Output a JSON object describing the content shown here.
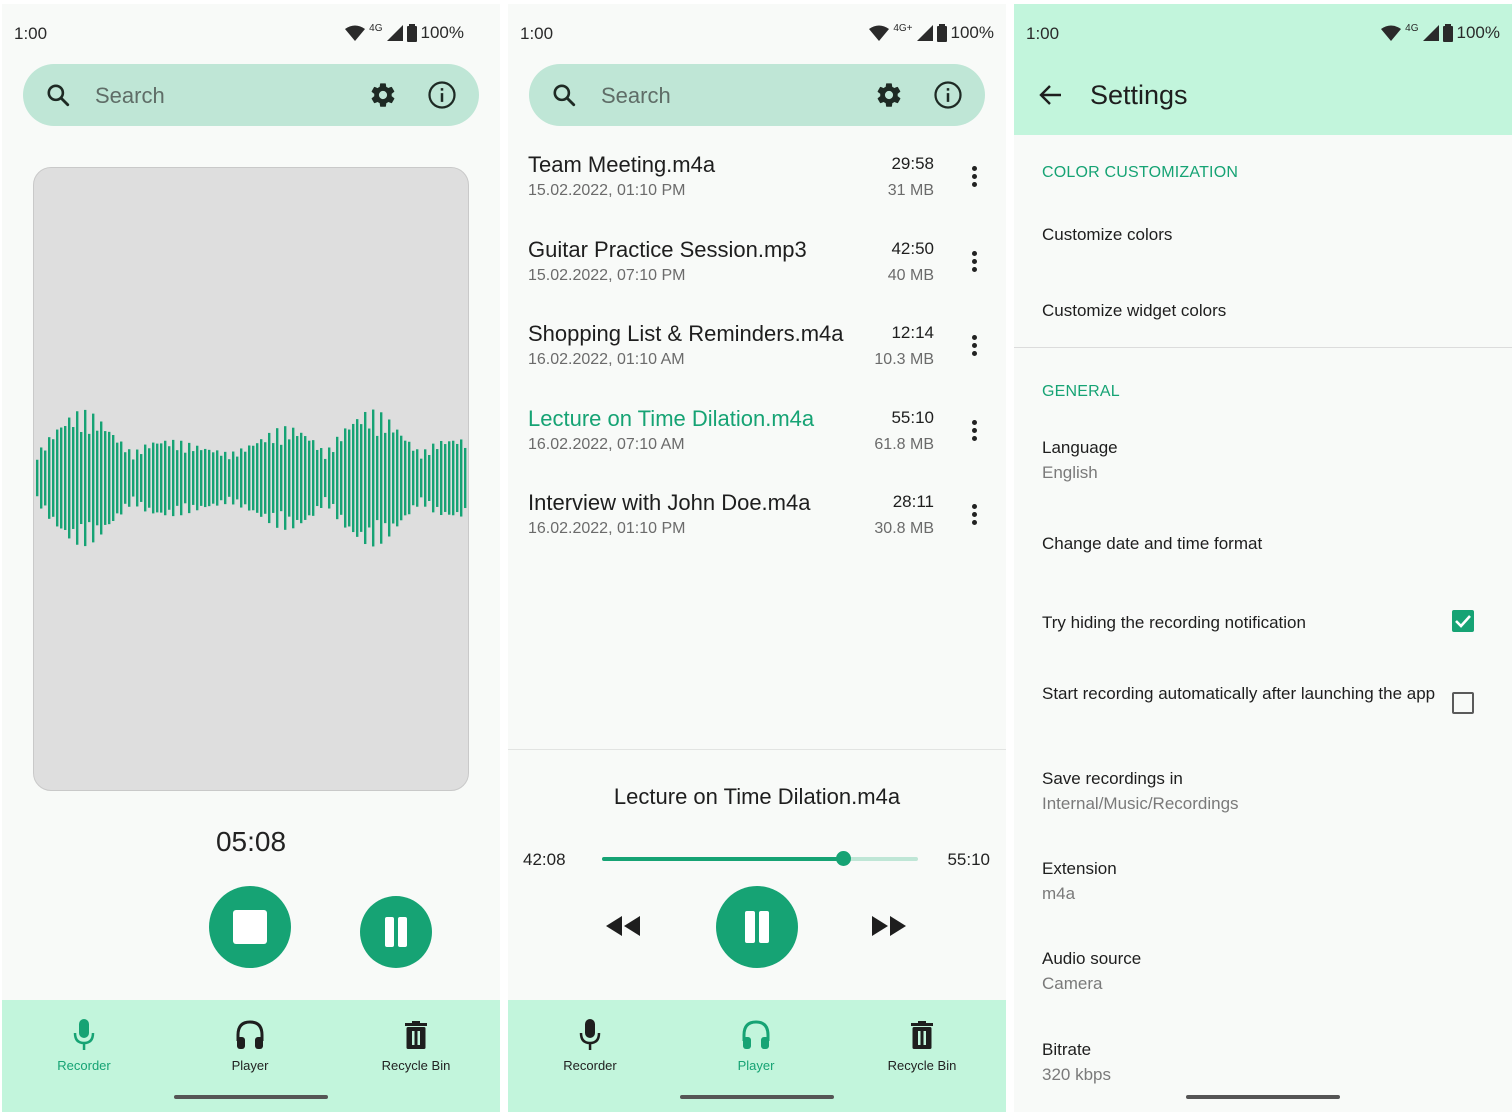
{
  "status": {
    "time": "1:00",
    "network_1": "4G",
    "network_2": "4G+",
    "network_3": "4G",
    "battery": "100%"
  },
  "search": {
    "placeholder": "Search"
  },
  "recorder": {
    "timer": "05:08"
  },
  "bottom_nav": {
    "recorder": "Recorder",
    "player": "Player",
    "recycle_bin": "Recycle Bin"
  },
  "recordings": [
    {
      "name": "Team Meeting.m4a",
      "date": "15.02.2022, 01:10 PM",
      "duration": "29:58",
      "size": "31 MB"
    },
    {
      "name": "Guitar Practice Session.mp3",
      "date": "15.02.2022, 07:10 PM",
      "duration": "42:50",
      "size": "40 MB"
    },
    {
      "name": "Shopping List & Reminders.m4a",
      "date": "16.02.2022, 01:10 AM",
      "duration": "12:14",
      "size": "10.3 MB"
    },
    {
      "name": "Lecture on Time Dilation.m4a",
      "date": "16.02.2022, 07:10 AM",
      "duration": "55:10",
      "size": "61.8 MB"
    },
    {
      "name": "Interview with John Doe.m4a",
      "date": "16.02.2022, 01:10 PM",
      "duration": "28:11",
      "size": "30.8 MB"
    }
  ],
  "player": {
    "title": "Lecture on Time Dilation.m4a",
    "position": "42:08",
    "duration": "55:10",
    "progress": 0.764
  },
  "settings": {
    "title": "Settings",
    "section_color": "COLOR CUSTOMIZATION",
    "customize_colors": "Customize colors",
    "customize_widget_colors": "Customize widget colors",
    "section_general": "GENERAL",
    "language": "Language",
    "language_value": "English",
    "date_time_format": "Change date and time format",
    "hide_notification": "Try hiding the recording notification",
    "hide_notification_checked": true,
    "auto_start": "Start recording automatically after launching the app",
    "auto_start_checked": false,
    "save_in": "Save recordings in",
    "save_in_value": "Internal/Music/Recordings",
    "extension": "Extension",
    "extension_value": "m4a",
    "audio_source": "Audio source",
    "audio_source_value": "Camera",
    "bitrate": "Bitrate",
    "bitrate_value": "320 kbps"
  },
  "colors": {
    "accent": "#16a374",
    "header_bg": "#c2f5dc",
    "search_bg": "#bfe6d6"
  }
}
